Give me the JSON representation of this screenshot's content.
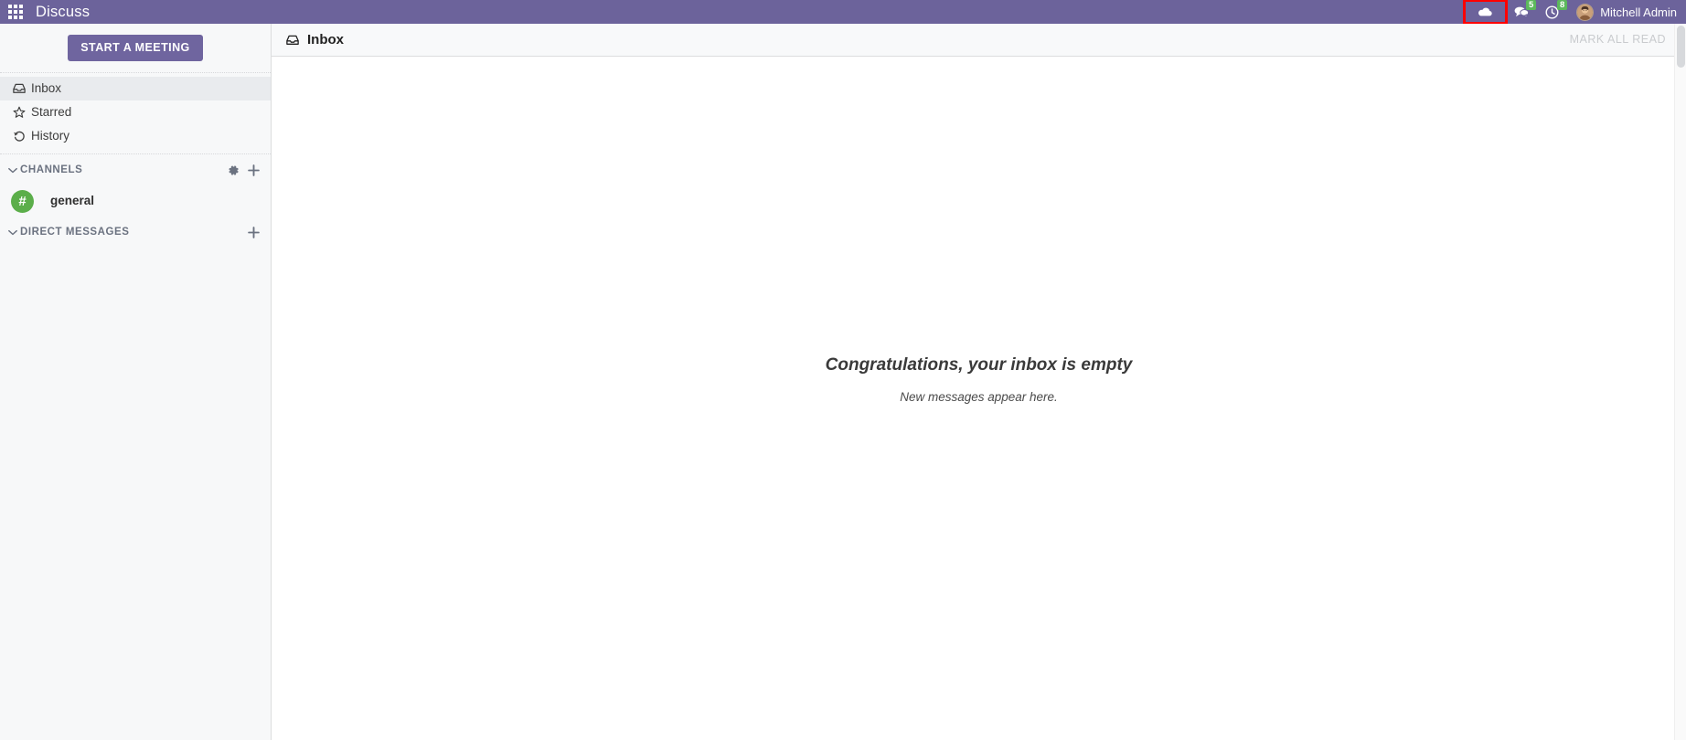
{
  "navbar": {
    "apps_icon": "apps-grid-icon",
    "brand": "Discuss",
    "cloud_icon": "cloud-icon",
    "messages_icon": "messages-icon",
    "messages_badge": "5",
    "activities_icon": "clock-icon",
    "activities_badge": "8",
    "avatar_icon": "user-avatar",
    "user_name": "Mitchell Admin",
    "highlight_color": "#FF0000",
    "background_color": "#6C639B",
    "badge_color": "#5CB85C"
  },
  "sidebar": {
    "start_meeting_label": "START A MEETING",
    "mailboxes": [
      {
        "label": "Inbox",
        "icon": "inbox-icon",
        "active": true
      },
      {
        "label": "Starred",
        "icon": "star-icon",
        "active": false
      },
      {
        "label": "History",
        "icon": "history-icon",
        "active": false
      }
    ],
    "channels_section": {
      "title": "CHANNELS",
      "caret_icon": "chevron-down-icon",
      "settings_icon": "gear-icon",
      "add_icon": "plus-icon",
      "items": [
        {
          "name": "general",
          "glyph": "#",
          "avatar_color": "#5BAE4A"
        }
      ]
    },
    "direct_messages_section": {
      "title": "DIRECT MESSAGES",
      "caret_icon": "chevron-down-icon",
      "add_icon": "plus-icon",
      "items": []
    }
  },
  "content": {
    "header": {
      "icon": "inbox-icon",
      "title": "Inbox",
      "mark_all_read_label": "MARK ALL READ"
    },
    "empty_state": {
      "title": "Congratulations, your inbox is empty",
      "subtitle": "New messages appear here."
    }
  }
}
